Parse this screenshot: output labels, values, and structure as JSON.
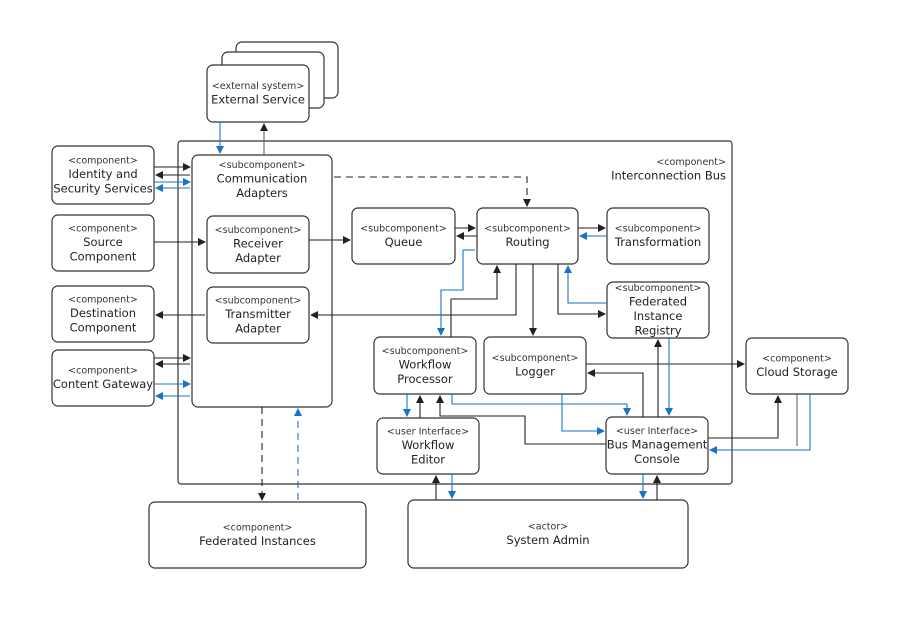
{
  "colors": {
    "line": "#222222",
    "accent_line": "#1a73c8",
    "box_border": "#333333"
  },
  "nodes": {
    "external_service": {
      "stereotype": "<external system>",
      "name": [
        "External Service"
      ]
    },
    "interconnection_bus": {
      "stereotype": "<component>",
      "name": [
        "Interconnection Bus"
      ]
    },
    "identity": {
      "stereotype": "<component>",
      "name": [
        "Identity and",
        "Security Services"
      ]
    },
    "source": {
      "stereotype": "<component>",
      "name": [
        "Source",
        "Component"
      ]
    },
    "destination": {
      "stereotype": "<component>",
      "name": [
        "Destination",
        "Component"
      ]
    },
    "content_gateway": {
      "stereotype": "<component>",
      "name": [
        "Content Gateway"
      ]
    },
    "comm_adapters": {
      "stereotype": "<subcomponent>",
      "name": [
        "Communication",
        "Adapters"
      ]
    },
    "receiver": {
      "stereotype": "<subcomponent>",
      "name": [
        "Receiver",
        "Adapter"
      ]
    },
    "transmitter": {
      "stereotype": "<subcomponent>",
      "name": [
        "Transmitter",
        "Adapter"
      ]
    },
    "queue": {
      "stereotype": "<subcomponent>",
      "name": [
        "Queue"
      ]
    },
    "routing": {
      "stereotype": "<subcomponent>",
      "name": [
        "Routing"
      ]
    },
    "transformation": {
      "stereotype": "<subcomponent>",
      "name": [
        "Transformation"
      ]
    },
    "registry": {
      "stereotype": "<subcomponent>",
      "name": [
        "Federated",
        "Instance",
        "Registry"
      ]
    },
    "workflow_processor": {
      "stereotype": "<subcomponent>",
      "name": [
        "Workflow",
        "Processor"
      ]
    },
    "logger": {
      "stereotype": "<subcomponent>",
      "name": [
        "Logger"
      ]
    },
    "cloud_storage": {
      "stereotype": "<component>",
      "name": [
        "Cloud Storage"
      ]
    },
    "workflow_editor": {
      "stereotype": "<user Interface>",
      "name": [
        "Workflow",
        "Editor"
      ]
    },
    "bus_console": {
      "stereotype": "<user Interface>",
      "name": [
        "Bus Management",
        "Console"
      ]
    },
    "federated_instances": {
      "stereotype": "<component>",
      "name": [
        "Federated Instances"
      ]
    },
    "system_admin": {
      "stereotype": "<actor>",
      "name": [
        "System Admin"
      ]
    }
  }
}
